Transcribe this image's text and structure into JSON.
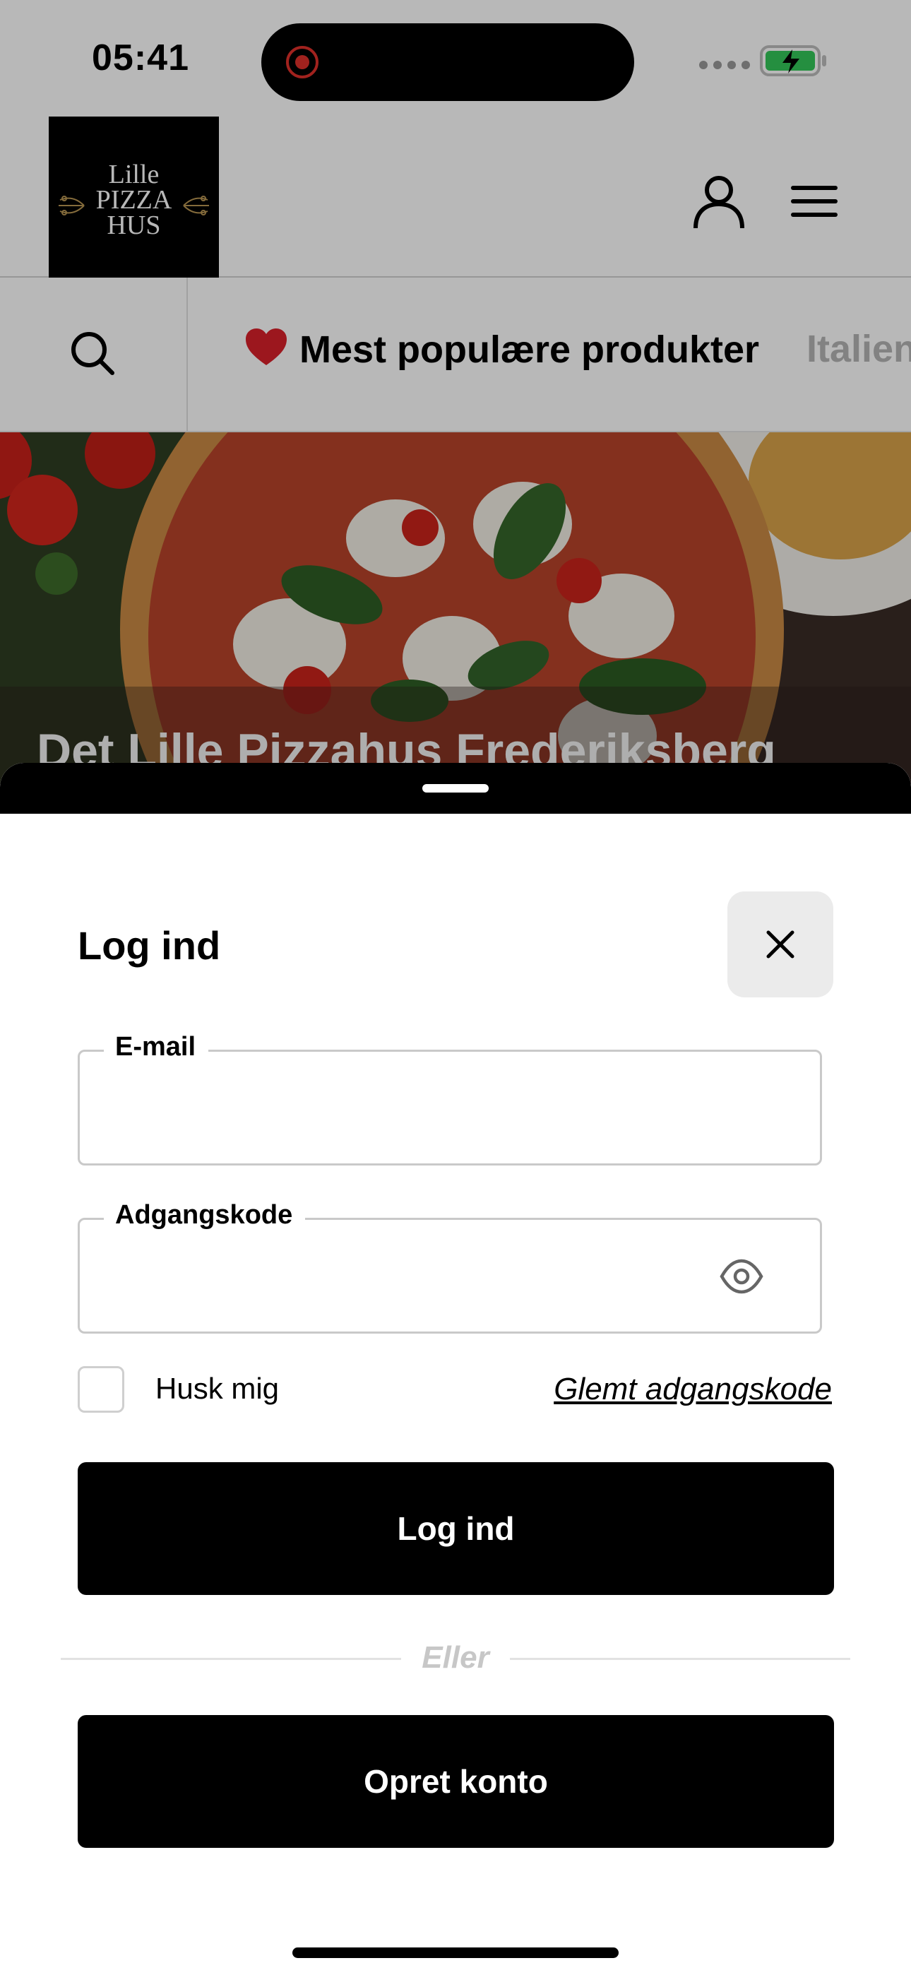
{
  "status_bar": {
    "time": "05:41"
  },
  "header": {
    "logo_lines": [
      "Lille",
      "PIZZA",
      "HUS"
    ],
    "icons": [
      "user-icon",
      "menu-icon"
    ]
  },
  "categories": {
    "search_icon": "search-icon",
    "items": [
      {
        "label": "Mest populære produkter",
        "icon": "heart-icon"
      },
      {
        "label": "Italien"
      }
    ]
  },
  "hero": {
    "title": "Det Lille Pizzahus Frederiksberg"
  },
  "login_sheet": {
    "title": "Log ind",
    "email": {
      "label": "E-mail",
      "value": ""
    },
    "password": {
      "label": "Adgangskode",
      "value": ""
    },
    "remember_label": "Husk mig",
    "forgot_link": "Glemt adgangskode",
    "login_button": "Log ind",
    "divider_text": "Eller",
    "create_button": "Opret konto"
  },
  "colors": {
    "primary": "#000000",
    "accent_heart": "#d8202a",
    "battery": "#34c759"
  }
}
